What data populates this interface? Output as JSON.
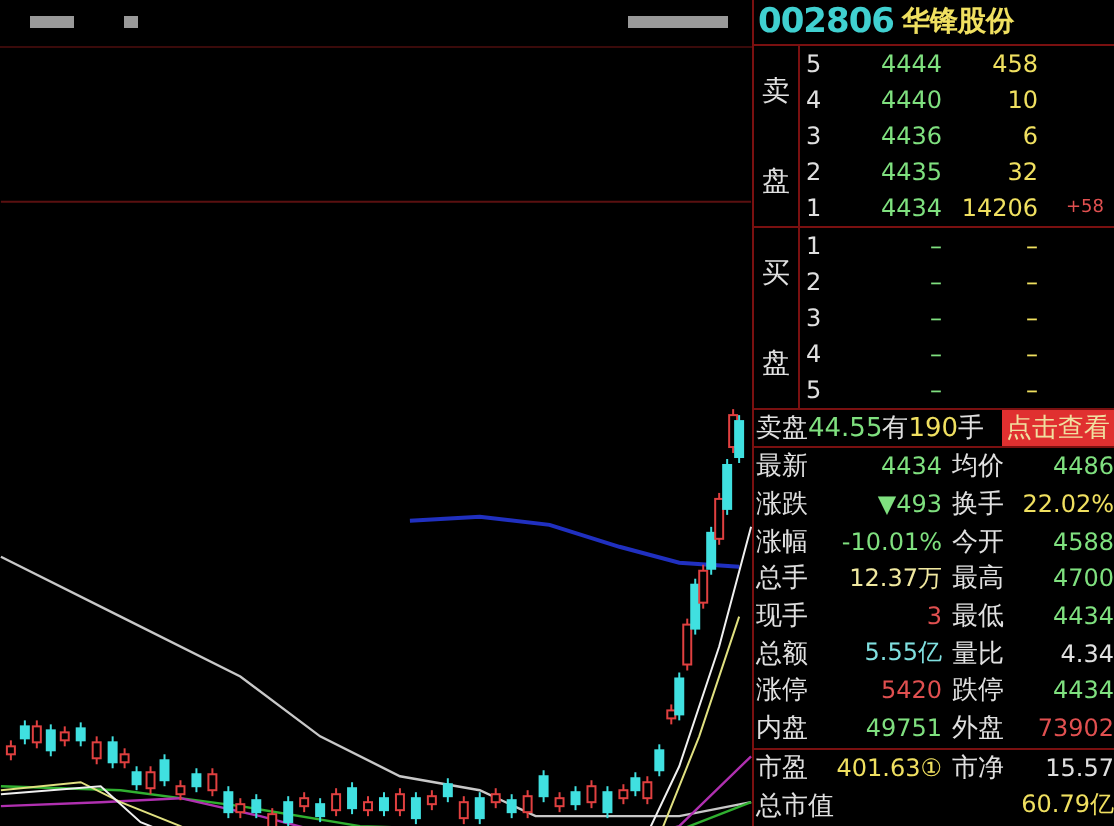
{
  "stock": {
    "code": "002806",
    "name": "华锋股份"
  },
  "sell_orders": {
    "label": [
      "卖",
      "盘"
    ],
    "rows": [
      {
        "rank": "5",
        "price": "4444",
        "volume": "458"
      },
      {
        "rank": "4",
        "price": "4440",
        "volume": "10"
      },
      {
        "rank": "3",
        "price": "4436",
        "volume": "6"
      },
      {
        "rank": "2",
        "price": "4435",
        "volume": "32"
      },
      {
        "rank": "1",
        "price": "4434",
        "volume": "14206",
        "change": "+58"
      }
    ]
  },
  "buy_orders": {
    "label": [
      "买",
      "盘"
    ],
    "rows": [
      {
        "rank": "1",
        "price": "–",
        "volume": "–"
      },
      {
        "rank": "2",
        "price": "–",
        "volume": "–"
      },
      {
        "rank": "3",
        "price": "–",
        "volume": "–"
      },
      {
        "rank": "4",
        "price": "–",
        "volume": "–"
      },
      {
        "rank": "5",
        "price": "–",
        "volume": "–"
      }
    ]
  },
  "notice": {
    "parts": [
      {
        "text": "卖盘",
        "color": "#e0e0e0"
      },
      {
        "text": "44.55",
        "color": "#7fe07f"
      },
      {
        "text": "有",
        "color": "#e0e0e0"
      },
      {
        "text": "190",
        "color": "#f0e060"
      },
      {
        "text": "手",
        "color": "#e0e0e0"
      }
    ],
    "button": "点击查看"
  },
  "stats": [
    {
      "left": {
        "label": "最新",
        "value": "4434",
        "color": "#7fe07f"
      },
      "right": {
        "label": "均价",
        "value": "4486",
        "color": "#7fe07f"
      }
    },
    {
      "left": {
        "label": "涨跌",
        "value": "▼493",
        "color": "#7fe07f"
      },
      "right": {
        "label": "换手",
        "value": "22.02%",
        "color": "#f0e060"
      }
    },
    {
      "left": {
        "label": "涨幅",
        "value": "-10.01%",
        "color": "#7fe07f"
      },
      "right": {
        "label": "今开",
        "value": "4588",
        "color": "#7fe07f"
      }
    },
    {
      "left": {
        "label": "总手",
        "value": "12.37万",
        "color": "#f0e8a0"
      },
      "right": {
        "label": "最高",
        "value": "4700",
        "color": "#7fe07f"
      }
    },
    {
      "left": {
        "label": "现手",
        "value": "3",
        "color": "#e05050"
      },
      "right": {
        "label": "最低",
        "value": "4434",
        "color": "#7fe07f"
      }
    },
    {
      "left": {
        "label": "总额",
        "value": "5.55亿",
        "color": "#80e0e0"
      },
      "right": {
        "label": "量比",
        "value": "4.34",
        "color": "#e0e0e0"
      }
    },
    {
      "left": {
        "label": "涨停",
        "value": "5420",
        "color": "#e05050"
      },
      "right": {
        "label": "跌停",
        "value": "4434",
        "color": "#7fe07f"
      }
    },
    {
      "left": {
        "label": "内盘",
        "value": "49751",
        "color": "#7fe07f"
      },
      "right": {
        "label": "外盘",
        "value": "73902",
        "color": "#e05050"
      }
    }
  ],
  "footer": [
    {
      "left": {
        "label": "市盈",
        "value": "401.63①",
        "color": "#f0e060"
      },
      "right": {
        "label": "市净",
        "value": "15.57",
        "color": "#e0e0e0"
      }
    },
    {
      "left": {
        "label": "总市值"
      },
      "right": {
        "value": "60.79亿",
        "color": "#f0e060"
      }
    }
  ]
}
